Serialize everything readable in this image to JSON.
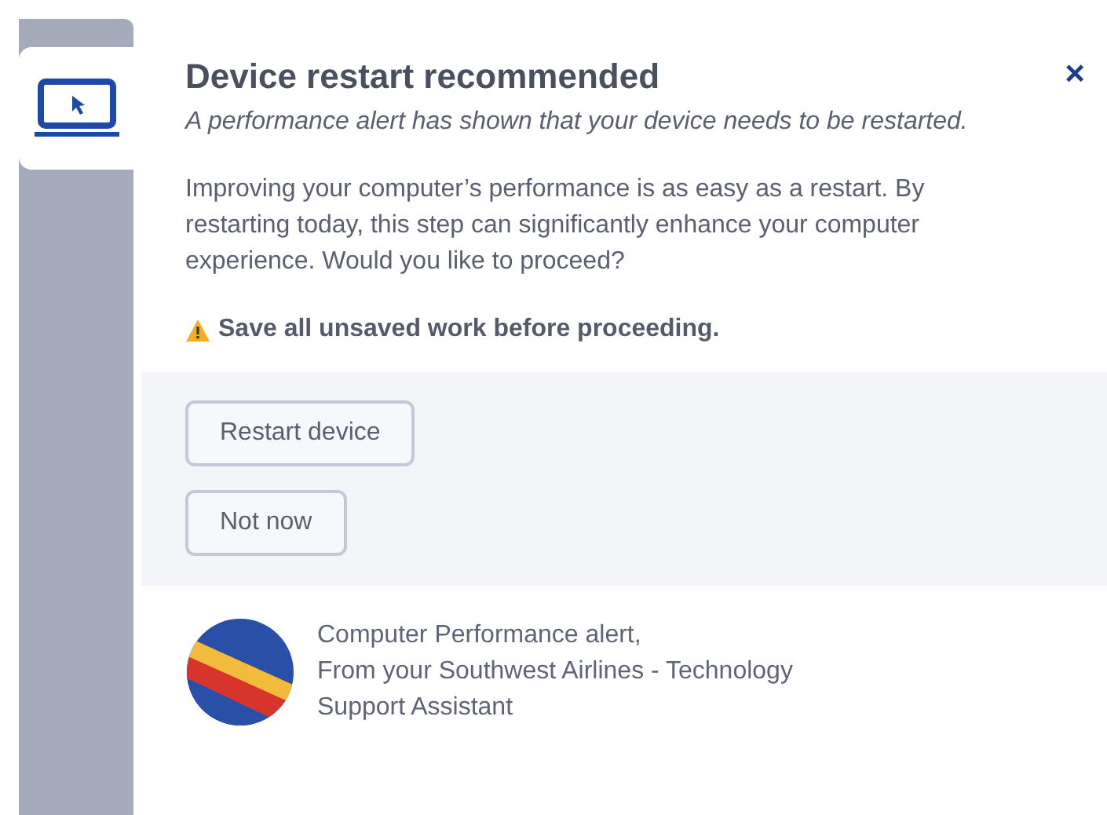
{
  "sidebar": {
    "tabs": [
      {
        "selected": true
      }
    ]
  },
  "close_label": "×",
  "title": "Device restart recommended",
  "subtitle": "A performance alert has shown that your device needs to be restarted.",
  "body": "Improving your computer’s performance is as easy as a restart. By restarting today, this step can significantly enhance your computer experience. Would you like to proceed?",
  "warning": "Save all unsaved work before proceeding.",
  "buttons": [
    "Restart device",
    "Not now"
  ],
  "footer": {
    "lines": [
      "Computer Performance alert,",
      "From your Southwest Airlines - Technology",
      "Support Assistant"
    ]
  }
}
